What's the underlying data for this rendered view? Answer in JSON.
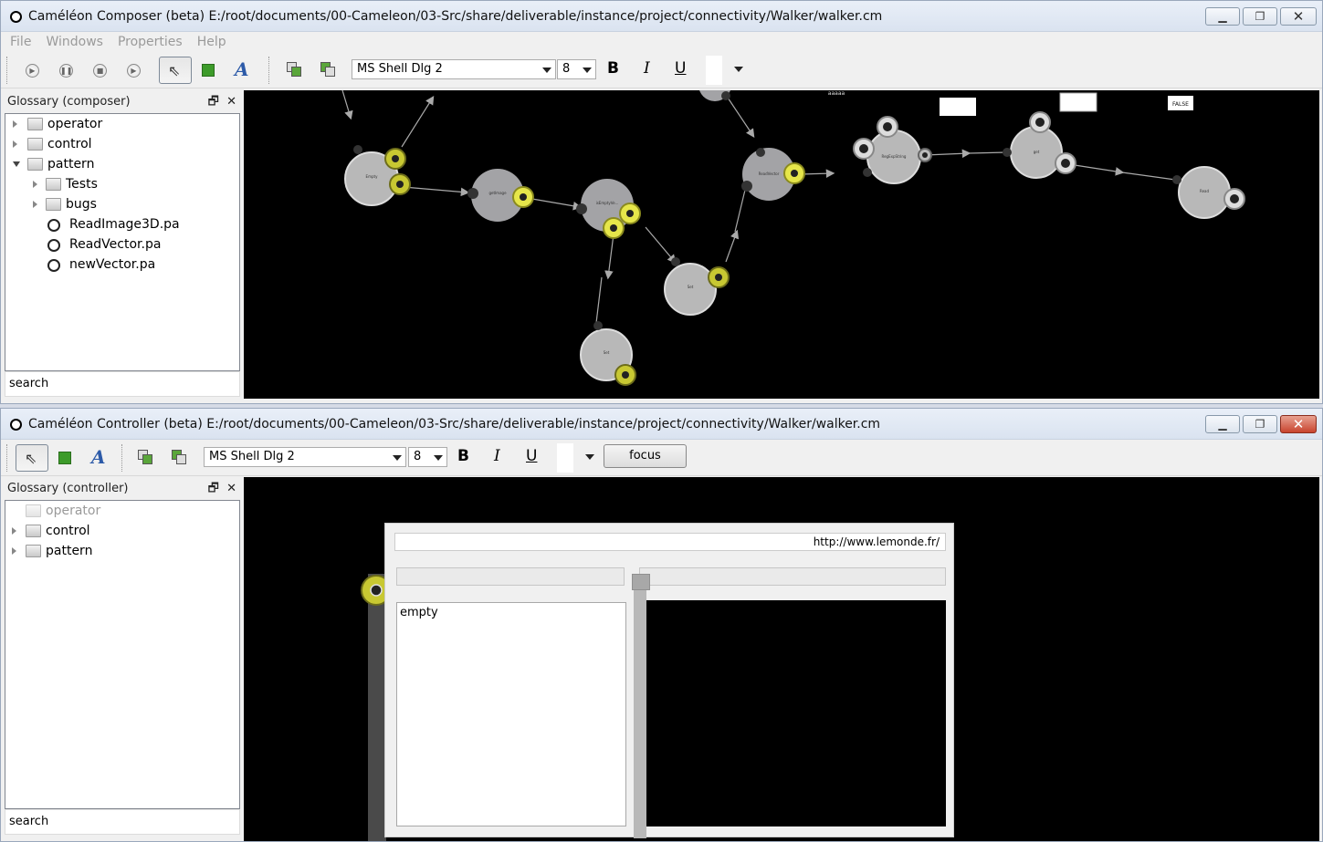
{
  "composer": {
    "title": "Caméléon Composer (beta) E:/root/documents/00-Cameleon/03-Src/share/deliverable/instance/project/connectivity/Walker/walker.cm",
    "menu": [
      "File",
      "Windows",
      "Properties",
      "Help"
    ],
    "toolbar": {
      "icons": [
        "play-icon",
        "pause-icon",
        "stop-icon",
        "step-icon",
        "pointer-icon",
        "rectangle-icon",
        "text-tool-icon",
        "bring-front-icon",
        "send-back-icon"
      ],
      "font": "MS Shell Dlg 2",
      "size": "8",
      "bold": "B",
      "italic": "I",
      "underline": "U"
    },
    "glossary": {
      "title": "Glossary (composer)",
      "items": [
        {
          "label": "operator",
          "type": "folder"
        },
        {
          "label": "control",
          "type": "folder"
        },
        {
          "label": "pattern",
          "type": "folder",
          "expanded": true
        },
        {
          "label": "Tests",
          "type": "folder"
        },
        {
          "label": "bugs",
          "type": "folder"
        },
        {
          "label": "ReadImage3D.pa",
          "type": "file"
        },
        {
          "label": "ReadVector.pa",
          "type": "file"
        },
        {
          "label": "newVector.pa",
          "type": "file"
        }
      ],
      "search": "search"
    },
    "graph": {
      "top_label": "aaaaa",
      "false_label": "FALSE"
    }
  },
  "controller": {
    "title": "Caméléon Controller (beta) E:/root/documents/00-Cameleon/03-Src/share/deliverable/instance/project/connectivity/Walker/walker.cm",
    "toolbar": {
      "font": "MS Shell Dlg 2",
      "size": "8",
      "bold": "B",
      "italic": "I",
      "underline": "U",
      "focus": "focus"
    },
    "glossary": {
      "title": "Glossary (controller)",
      "items": [
        {
          "label": "operator",
          "type": "folder",
          "disabled": true
        },
        {
          "label": "control",
          "type": "folder"
        },
        {
          "label": "pattern",
          "type": "folder"
        }
      ],
      "search": "search"
    },
    "browser": {
      "url": "http://www.lemonde.fr/",
      "text": "empty"
    }
  },
  "colors": {
    "canvas": "#000000",
    "node": "#b8b8b8",
    "active_plug": "#c8c832",
    "edge": "#aaaaaa"
  }
}
